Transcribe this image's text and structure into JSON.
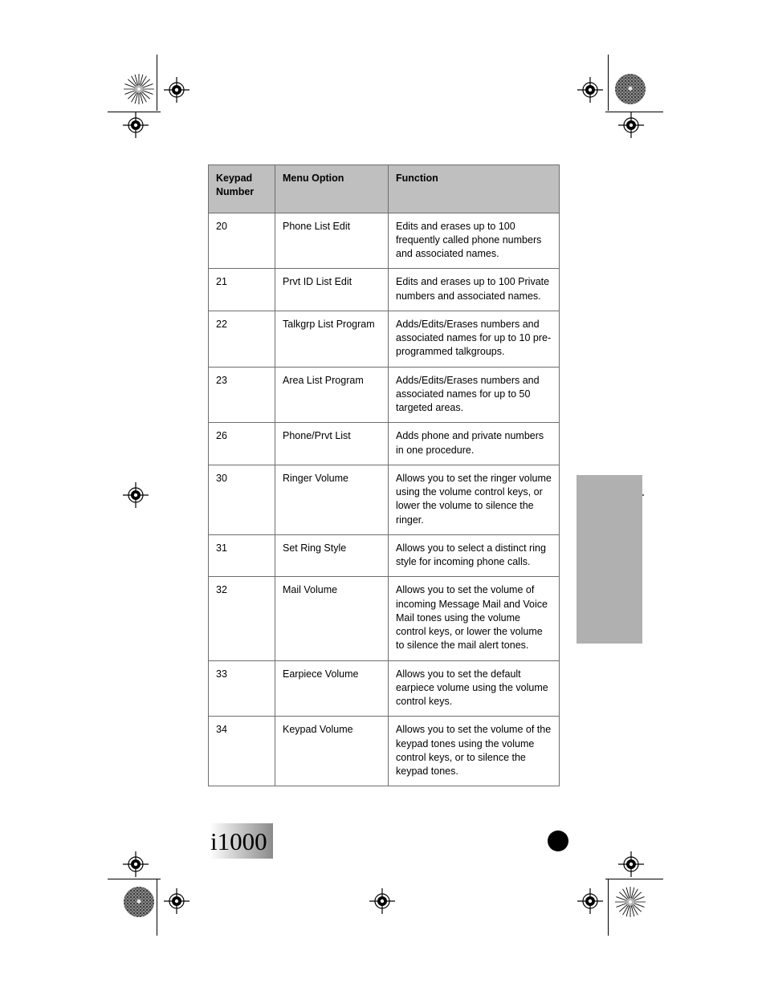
{
  "document": {
    "footer_label": "i1000"
  },
  "table": {
    "headers": [
      "Keypad Number",
      "Menu Option",
      "Function"
    ],
    "header_keypad_line1": "Keypad",
    "header_keypad_line2": "Number",
    "rows": [
      {
        "number": "20",
        "menu_option": "Phone List Edit",
        "function": "Edits and erases up to 100 frequently called phone numbers and associated names."
      },
      {
        "number": "21",
        "menu_option": "Prvt ID List Edit",
        "function": "Edits and erases up to 100 Private numbers and associated names."
      },
      {
        "number": "22",
        "menu_option": "Talkgrp List Program",
        "function": "Adds/Edits/Erases numbers and associated names for up to 10 pre-programmed talkgroups."
      },
      {
        "number": "23",
        "menu_option": "Area List Program",
        "function": "Adds/Edits/Erases numbers and associated names for up to 50 targeted areas."
      },
      {
        "number": "26",
        "menu_option": "Phone/Prvt List",
        "function": "Adds phone and private numbers in one procedure."
      },
      {
        "number": "30",
        "menu_option": "Ringer Volume",
        "function": "Allows you to set the ringer volume using the volume control keys, or lower the volume to silence the ringer."
      },
      {
        "number": "31",
        "menu_option": "Set Ring Style",
        "function": "Allows you to select a distinct ring style for incoming phone calls."
      },
      {
        "number": "32",
        "menu_option": "Mail Volume",
        "function": "Allows you to set the volume of incoming Message Mail and Voice Mail tones using the volume control keys, or lower the volume to silence the mail alert tones."
      },
      {
        "number": "33",
        "menu_option": "Earpiece Volume",
        "function": "Allows you to set the default earpiece volume using the volume control keys."
      },
      {
        "number": "34",
        "menu_option": "Keypad Volume",
        "function": "Allows you to set the volume of the keypad tones using the volume control keys, or to silence the keypad tones."
      }
    ]
  },
  "colors": {
    "header_fill": "#bfbfbf",
    "tab_fill": "#b0b0b0",
    "border": "#6d6d6d",
    "text": "#000000"
  }
}
